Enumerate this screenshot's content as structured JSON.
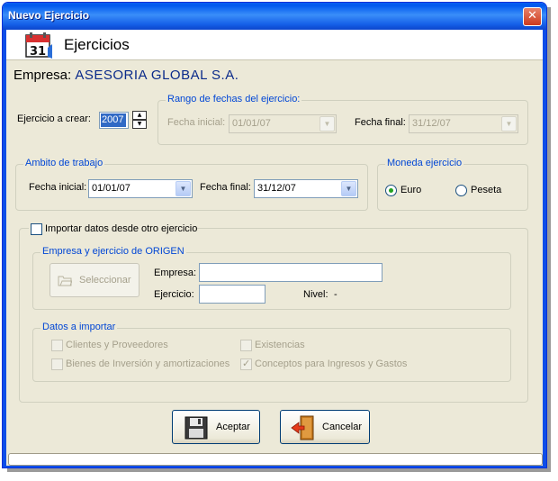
{
  "window": {
    "title": "Nuevo Ejercicio",
    "close_label": "✕"
  },
  "header": {
    "title": "Ejercicios",
    "icon": "calendar-icon",
    "icon_text": "31"
  },
  "empresa": {
    "label": "Empresa:",
    "name": "ASESORIA GLOBAL S.A."
  },
  "ejercicio": {
    "label": "Ejercicio a crear:",
    "value": "2007"
  },
  "rango": {
    "legend": "Rango de fechas del ejercicio:",
    "fecha_inicial_label": "Fecha inicial:",
    "fecha_inicial_value": "01/01/07",
    "fecha_final_label": "Fecha final:",
    "fecha_final_value": "31/12/07"
  },
  "ambito": {
    "legend": "Ambito de trabajo",
    "fecha_inicial_label": "Fecha inicial:",
    "fecha_inicial_value": "01/01/07",
    "fecha_final_label": "Fecha final:",
    "fecha_final_value": "31/12/07"
  },
  "moneda": {
    "legend": "Moneda ejercicio",
    "options": [
      {
        "label": "Euro",
        "checked": true
      },
      {
        "label": "Peseta",
        "checked": false
      }
    ]
  },
  "importar": {
    "checkbox_label": "Importar datos desde otro ejercicio",
    "checked": false,
    "origen": {
      "legend": "Empresa y ejercicio de ORIGEN",
      "seleccionar_label": "Seleccionar",
      "empresa_label": "Empresa:",
      "empresa_value": "",
      "ejercicio_label": "Ejercicio:",
      "ejercicio_value": "",
      "nivel_label": "Nivel:",
      "nivel_value": "-"
    },
    "datos": {
      "legend": "Datos a importar",
      "items": [
        {
          "label": "Clientes y Proveedores",
          "checked": false
        },
        {
          "label": "Existencias",
          "checked": false
        },
        {
          "label": "Bienes de Inversión y amortizaciones",
          "checked": false
        },
        {
          "label": "Conceptos para Ingresos y Gastos",
          "checked": true
        }
      ]
    }
  },
  "buttons": {
    "aceptar": "Aceptar",
    "cancelar": "Cancelar"
  },
  "colors": {
    "title_blue": "#0058ee",
    "accent_blue": "#0046d5",
    "dialog_bg": "#ece9d8"
  }
}
